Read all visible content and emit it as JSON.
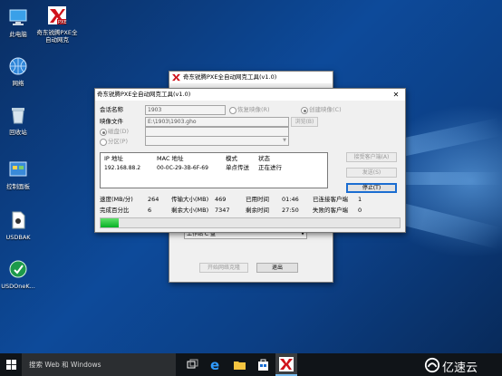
{
  "desktop": {
    "icons": [
      {
        "label": "此电脑"
      },
      {
        "label": "奇东锐腾PXE全自动网克"
      },
      {
        "label": "网络"
      },
      {
        "label": "回收站"
      },
      {
        "label": "控制面板"
      },
      {
        "label": "USDBAK"
      },
      {
        "label": "USDOneK..."
      }
    ]
  },
  "back_window": {
    "title": "奇东锐腾PXE全自动网克工具(v1.0)",
    "dropdown_value": "工作站 C 盘",
    "start_button": "开始网络克隆",
    "exit_button": "退出"
  },
  "main_window": {
    "title": "奇东锐腾PXE全自动网克工具(v1.0)",
    "session_label": "会话名称",
    "session_value": "1903",
    "restore_label": "恢复映像(R)",
    "create_label": "创建映像(C)",
    "image_label": "映像文件",
    "image_value": "E:\\1903\\1903.gho",
    "browse_button": "浏览(B)",
    "disk_label": "磁盘(D)",
    "partition_label": "分区(P)",
    "columns": [
      "IP 地址",
      "MAC 地址",
      "模式",
      "状态"
    ],
    "clients": [
      {
        "ip": "192.168.88.2",
        "mac": "00-0C-29-3B-6F-69",
        "mode": "单点传送",
        "status": "正在进行"
      }
    ],
    "accept_button": "接受客户端(A)",
    "send_button": "发送(S)",
    "stop_button": "停止(T)",
    "stats": {
      "speed_label": "速度(MB/分)",
      "speed_value": "264",
      "transferred_label": "传输大小(MB)",
      "transferred_value": "469",
      "elapsed_label": "已用时间",
      "elapsed_value": "01:46",
      "connected_label": "已连接客户端",
      "connected_value": "1",
      "percent_label": "完成百分比",
      "percent_value": "6",
      "remaining_label": "剩余大小(MB)",
      "remaining_value": "7347",
      "remaining_time_label": "剩余时间",
      "remaining_time_value": "27:50",
      "failed_label": "失败的客户端",
      "failed_value": "0"
    },
    "progress_percent": 6
  },
  "taskbar": {
    "search_placeholder": "搜索 Web 和 Windows",
    "icons": [
      "task-view-icon",
      "edge-icon",
      "file-explorer-icon",
      "store-icon",
      "pxe-tool-icon"
    ]
  },
  "colors": {
    "accent": "#1b6dd1",
    "progress": "#06b025",
    "wallpaper": "#0d4a9a"
  }
}
